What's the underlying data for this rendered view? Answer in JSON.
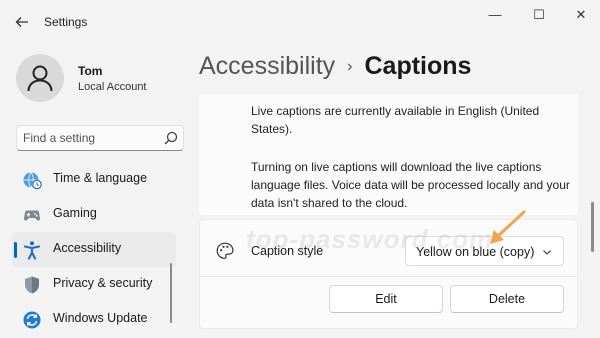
{
  "titlebar": {
    "back_icon": "back-arrow-icon",
    "app_title": "Settings",
    "minimize_glyph": "—",
    "maximize_glyph": "☐",
    "close_glyph": "✕"
  },
  "profile": {
    "name": "Tom",
    "account_type": "Local Account"
  },
  "search": {
    "placeholder": "Find a setting",
    "value": ""
  },
  "sidebar": {
    "items": [
      {
        "label": "Time & language",
        "icon": "globe-clock-icon",
        "active": false
      },
      {
        "label": "Gaming",
        "icon": "gamepad-icon",
        "active": false
      },
      {
        "label": "Accessibility",
        "icon": "accessibility-icon",
        "active": true
      },
      {
        "label": "Privacy & security",
        "icon": "shield-icon",
        "active": false
      },
      {
        "label": "Windows Update",
        "icon": "update-icon",
        "active": false
      }
    ]
  },
  "breadcrumb": {
    "parent": "Accessibility",
    "separator": "›",
    "current": "Captions"
  },
  "info": {
    "paragraph1": "Live captions are currently available in English (United States).",
    "paragraph2": "Turning on live captions will download the live captions language files. Voice data will be processed locally and your data isn't shared to the cloud."
  },
  "caption_style": {
    "label": "Caption style",
    "selected": "Yellow on blue (copy)",
    "edit_label": "Edit",
    "delete_label": "Delete"
  },
  "watermark": "top-password.com",
  "colors": {
    "accent": "#0067c0",
    "annotation_arrow": "#f0a64a"
  }
}
